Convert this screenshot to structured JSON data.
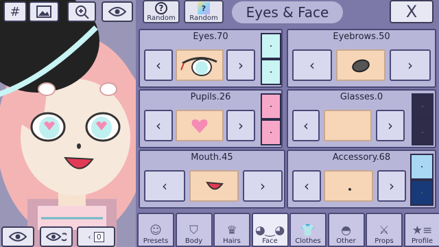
{
  "toolbar_left": {
    "hash_label": "#",
    "image_icon": "image-icon",
    "zoom_icon": "zoom-in-icon",
    "eye_icon": "eye-icon"
  },
  "bottom_left": {
    "counter": "0"
  },
  "top_bar": {
    "random1_label": "Random",
    "random2_label": "Random",
    "title": "Eyes & Face",
    "close_label": "X"
  },
  "cards": {
    "eyes": {
      "label": "Eyes.70"
    },
    "eyebrows": {
      "label": "Eyebrows.50"
    },
    "pupils": {
      "label": "Pupils.26"
    },
    "glasses": {
      "label": "Glasses.0"
    },
    "mouth": {
      "label": "Mouth.45"
    },
    "accessory": {
      "label": "Accessory.68"
    }
  },
  "swatches": {
    "eyes": [
      "#c8f4f4",
      "#c8f4f4"
    ],
    "pupils": [
      "#f7a8c8",
      "#f7a8c8"
    ],
    "glasses": [
      "#2e2c48",
      "#2e2c48"
    ],
    "accessory": [
      "#a8d8f4",
      "#183a78"
    ]
  },
  "tabs": [
    {
      "label": "Presets",
      "icon": "person-icon",
      "glyph": "☺"
    },
    {
      "label": "Body",
      "icon": "jacket-icon",
      "glyph": "⛉"
    },
    {
      "label": "Hairs",
      "icon": "hair-icon",
      "glyph": "♛"
    },
    {
      "label": "Face",
      "icon": "face-icon",
      "glyph": "◕‿◕"
    },
    {
      "label": "Clothes",
      "icon": "shirt-icon",
      "glyph": "👕"
    },
    {
      "label": "Other",
      "icon": "cap-icon",
      "glyph": "◓"
    },
    {
      "label": "Props",
      "icon": "sword-icon",
      "glyph": "⚔"
    },
    {
      "label": "Profile",
      "icon": "profile-icon",
      "glyph": "★≡"
    }
  ],
  "colors": {
    "panel_bg": "#7c78a8",
    "card_bg": "#b8b6d8",
    "skin": "#f7d6b8",
    "hair": "#f4b4b4"
  }
}
